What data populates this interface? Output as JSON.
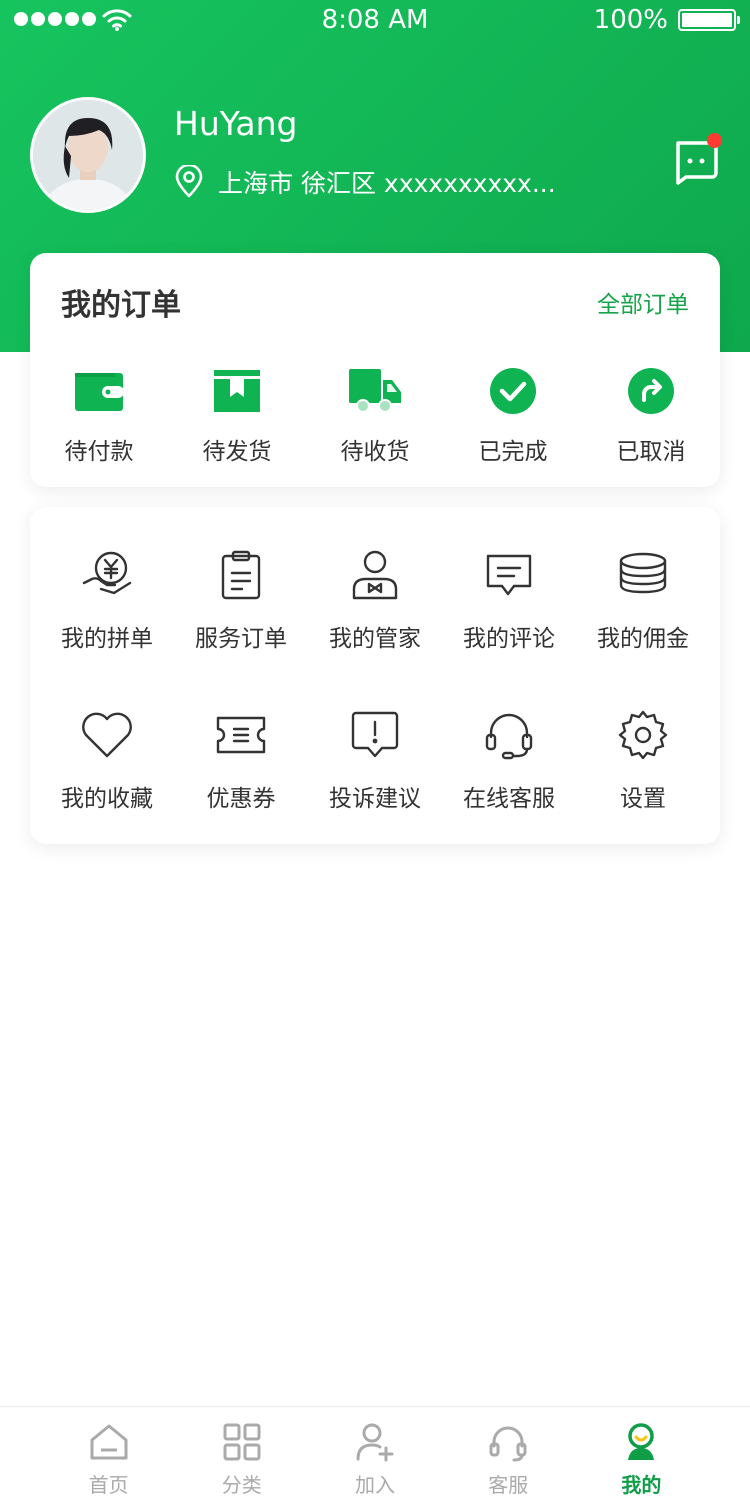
{
  "status_bar": {
    "time": "8:08 AM",
    "battery": "100%"
  },
  "profile": {
    "username": "HuYang",
    "location": "上海市 徐汇区 xxxxxxxxxx...",
    "avatar_icon": "avatar"
  },
  "colors": {
    "brand": "#10b352",
    "badge": "#ff3b30",
    "icon_dark": "#333333"
  },
  "orders": {
    "title": "我的订单",
    "all_link": "全部订单",
    "items": [
      {
        "label": "待付款",
        "icon": "wallet-icon"
      },
      {
        "label": "待发货",
        "icon": "package-icon"
      },
      {
        "label": "待收货",
        "icon": "truck-icon"
      },
      {
        "label": "已完成",
        "icon": "check-circle-icon"
      },
      {
        "label": "已取消",
        "icon": "return-arrow-icon"
      }
    ]
  },
  "services": {
    "items": [
      {
        "label": "我的拼单",
        "icon": "yen-hand-icon"
      },
      {
        "label": "服务订单",
        "icon": "clipboard-icon"
      },
      {
        "label": "我的管家",
        "icon": "butler-icon"
      },
      {
        "label": "我的评论",
        "icon": "comment-icon"
      },
      {
        "label": "我的佣金",
        "icon": "coins-icon"
      },
      {
        "label": "我的收藏",
        "icon": "heart-icon"
      },
      {
        "label": "优惠券",
        "icon": "coupon-icon"
      },
      {
        "label": "投诉建议",
        "icon": "complaint-icon"
      },
      {
        "label": "在线客服",
        "icon": "headset-icon"
      },
      {
        "label": "设置",
        "icon": "gear-icon"
      }
    ]
  },
  "tab_bar": {
    "items": [
      {
        "label": "首页",
        "icon": "home-icon"
      },
      {
        "label": "分类",
        "icon": "grid-icon"
      },
      {
        "label": "加入",
        "icon": "add-user-icon"
      },
      {
        "label": "客服",
        "icon": "headphones-icon"
      },
      {
        "label": "我的",
        "icon": "profile-icon",
        "active": true
      }
    ]
  }
}
